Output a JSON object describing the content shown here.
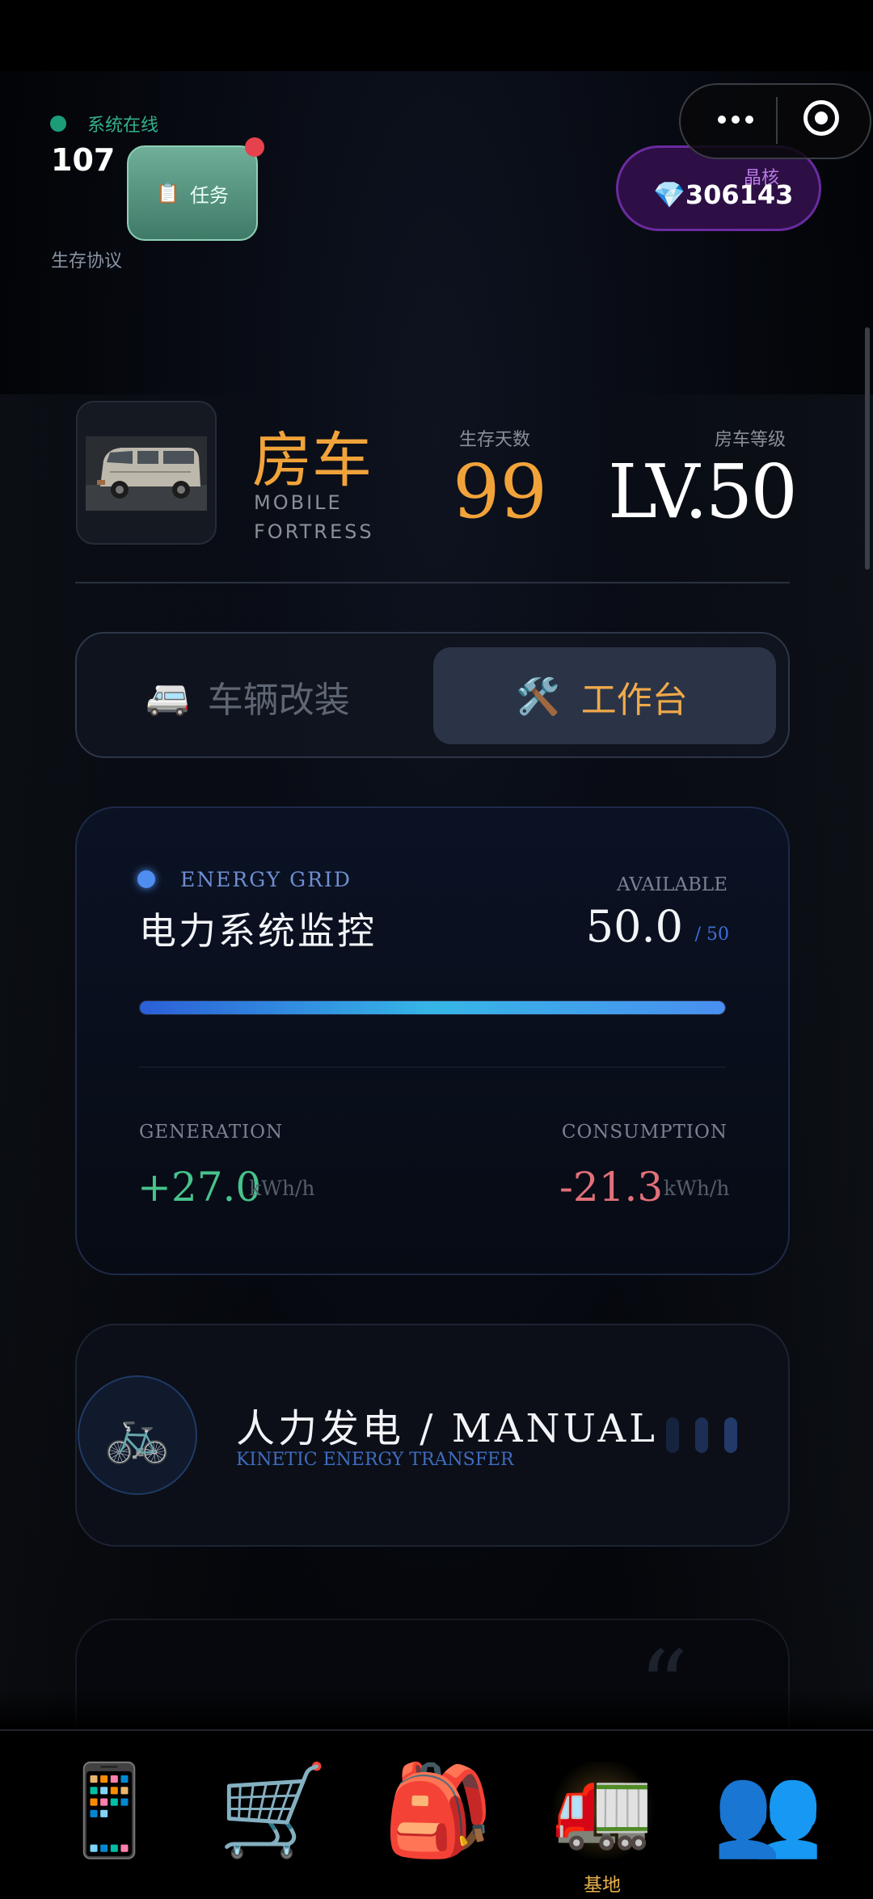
{
  "header": {
    "status_text": "系统在线",
    "count": "107",
    "task_button_label": "任务",
    "task_icon": "clipboard-icon",
    "protocol_text": "生存协议",
    "crystal_label": "晶核",
    "crystal_value": "💎306143",
    "capsule_more_icon": "more-dots-icon",
    "capsule_target_icon": "target-icon"
  },
  "vehicle": {
    "name": "房车",
    "subtitle": "MOBILE FORTRESS",
    "days_label": "生存天数",
    "days_value": "99",
    "level_label": "房车等级",
    "level_value": "LV.50"
  },
  "tabs": [
    {
      "icon": "🚐",
      "label": "车辆改装",
      "active": false
    },
    {
      "icon": "🛠️",
      "label": "工作台",
      "active": true
    }
  ],
  "energy": {
    "label": "ENERGY GRID",
    "title": "电力系统监控",
    "available_label": "AVAILABLE",
    "available_value": "50.0",
    "available_max": "/ 50",
    "fill_fraction": 1.0,
    "generation_label": "GENERATION",
    "generation_value": "+27.0",
    "generation_unit": "kWh/h",
    "consumption_label": "CONSUMPTION",
    "consumption_value": "-21.3",
    "consumption_unit": "kWh/h"
  },
  "manual": {
    "icon": "🚲",
    "title": "人力发电 / MANUAL",
    "subtitle": "KINETIC ENERGY TRANSFER"
  },
  "nav": [
    {
      "icon": "📱",
      "label": ""
    },
    {
      "icon": "🛒",
      "label": ""
    },
    {
      "icon": "🎒",
      "label": ""
    },
    {
      "icon": "🚛",
      "label": "基地"
    },
    {
      "icon": "👥",
      "label": ""
    }
  ],
  "colors": {
    "accent_orange": "#f1a33a",
    "online_green": "#34b08e",
    "generation_green": "#47c38b",
    "consumption_red": "#e2707a",
    "energy_blue": "#4f8df0"
  }
}
